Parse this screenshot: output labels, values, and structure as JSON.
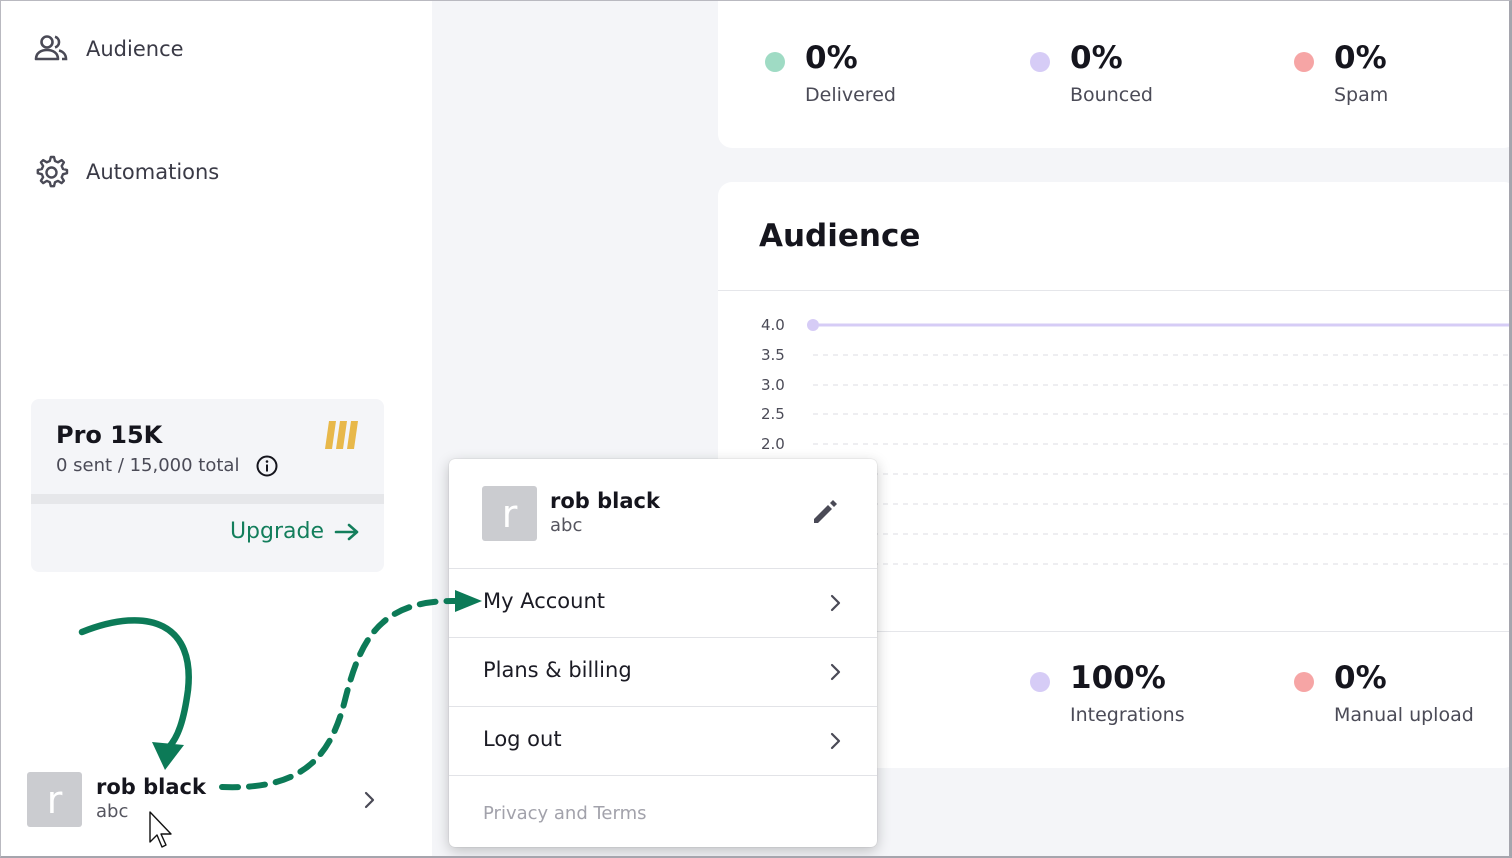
{
  "sidebar": {
    "nav": [
      {
        "label": "Audience",
        "icon": "users-icon"
      },
      {
        "label": "Automations",
        "icon": "gear-icon"
      }
    ],
    "plan": {
      "name": "Pro 15K",
      "usage": "0 sent / 15,000 total",
      "upgrade_label": "Upgrade",
      "accent": "#e8b84a"
    },
    "user": {
      "avatar_letter": "r",
      "name": "rob black",
      "sub": "abc"
    }
  },
  "stats_top": [
    {
      "value": "0%",
      "label": "Delivered",
      "color": "#9fdbc4"
    },
    {
      "value": "0%",
      "label": "Bounced",
      "color": "#d6ccf6"
    },
    {
      "value": "0%",
      "label": "Spam",
      "color": "#f6a5a5"
    }
  ],
  "audience": {
    "title": "Audience",
    "stats": [
      {
        "value": "100%",
        "label": "Integrations",
        "color": "#d6ccf6"
      },
      {
        "value": "0%",
        "label": "Manual upload",
        "color": "#f6a5a5"
      }
    ]
  },
  "chart_data": {
    "type": "line",
    "title": "Audience",
    "yticks": [
      "4.0",
      "3.5",
      "3.0",
      "2.5",
      "2.0"
    ],
    "series": [
      {
        "values": [
          4.0,
          4.0
        ]
      }
    ],
    "line_color": "#d6ccf6",
    "grid": "dashed"
  },
  "menu": {
    "user": {
      "avatar_letter": "r",
      "name": "rob black",
      "sub": "abc"
    },
    "items": [
      {
        "label": "My Account"
      },
      {
        "label": "Plans & billing"
      },
      {
        "label": "Log out"
      }
    ],
    "footer": "Privacy and Terms"
  },
  "colors": {
    "brand": "#137e5c",
    "annotation": "#0c7a57"
  }
}
